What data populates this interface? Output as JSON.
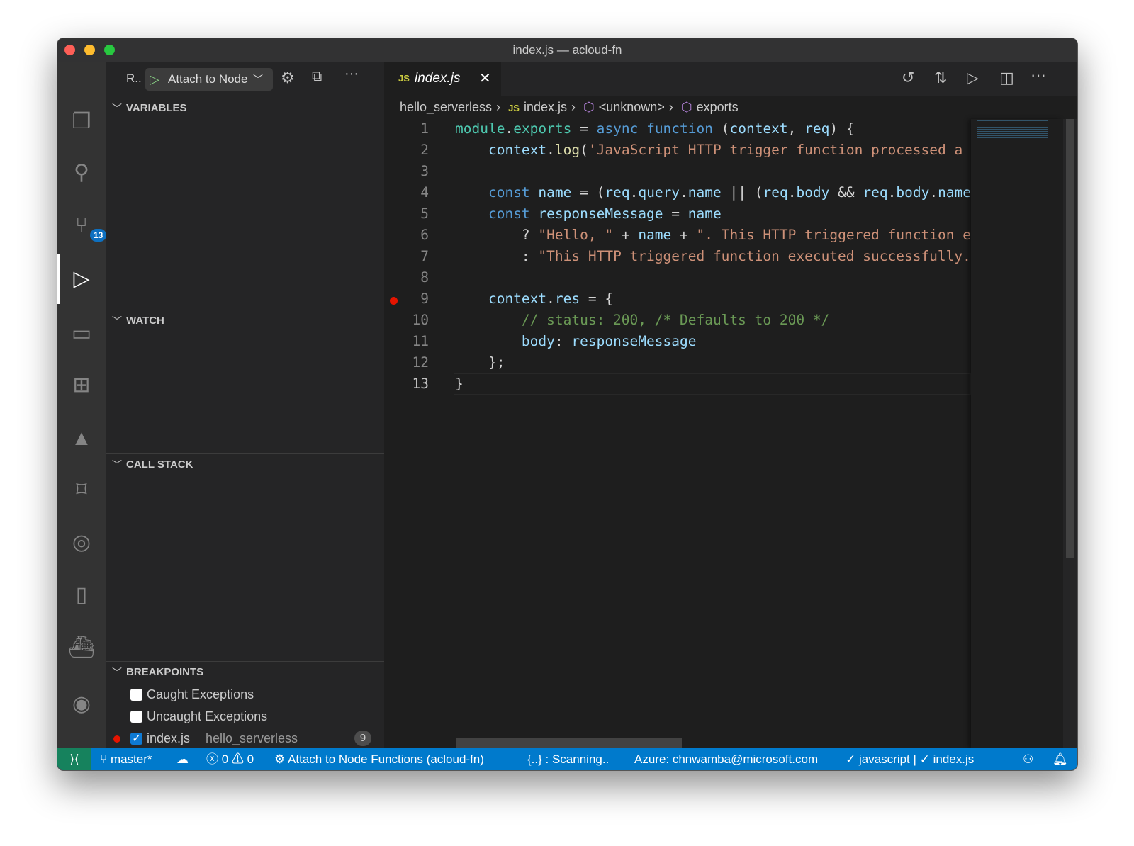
{
  "window": {
    "title": "index.js — acloud-fn"
  },
  "activity_bar": {
    "items": [
      "explorer-icon",
      "search-icon",
      "source-control-icon",
      "run-debug-icon",
      "remote-explorer-icon",
      "extensions-icon",
      "azure-icon",
      "bookmarks-icon",
      "git-graph-icon",
      "book-icon",
      "docker-icon",
      "account-icon",
      "settings-gear-icon"
    ],
    "scm_badge": "13"
  },
  "debug_toolbar": {
    "run_label": "R..",
    "config": "Attach to Node"
  },
  "sidebar": {
    "variables": "VARIABLES",
    "watch": "WATCH",
    "call_stack": "CALL STACK",
    "breakpoints": "BREAKPOINTS",
    "breakpoint_items": [
      {
        "label": "Caught Exceptions",
        "checked": false
      },
      {
        "label": "Uncaught Exceptions",
        "checked": false
      },
      {
        "label": "index.js",
        "path": "hello_serverless",
        "line": "9",
        "checked": true
      }
    ]
  },
  "editor": {
    "tab": {
      "label": "index.js",
      "icon": "JS"
    },
    "breadcrumb": [
      "hello_serverless",
      "index.js",
      "<unknown>",
      "exports"
    ],
    "current_line": "13",
    "breakpoint_line": "9",
    "lines": [
      [
        [
          "t",
          "module"
        ],
        [
          "p",
          "."
        ],
        [
          "t",
          "exports"
        ],
        [
          "p",
          " = "
        ],
        [
          "k",
          "async"
        ],
        [
          "p",
          " "
        ],
        [
          "k",
          "function"
        ],
        [
          "p",
          " ("
        ],
        [
          "v",
          "context"
        ],
        [
          "p",
          ", "
        ],
        [
          "v",
          "req"
        ],
        [
          "p",
          ") {"
        ]
      ],
      [
        [
          "p",
          "    "
        ],
        [
          "v",
          "context"
        ],
        [
          "p",
          "."
        ],
        [
          "f",
          "log"
        ],
        [
          "p",
          "("
        ],
        [
          "s",
          "'JavaScript HTTP trigger function processed a r"
        ]
      ],
      [],
      [
        [
          "p",
          "    "
        ],
        [
          "k",
          "const"
        ],
        [
          "p",
          " "
        ],
        [
          "v",
          "name"
        ],
        [
          "p",
          " = ("
        ],
        [
          "v",
          "req"
        ],
        [
          "p",
          "."
        ],
        [
          "v",
          "query"
        ],
        [
          "p",
          "."
        ],
        [
          "v",
          "name"
        ],
        [
          "p",
          " || ("
        ],
        [
          "v",
          "req"
        ],
        [
          "p",
          "."
        ],
        [
          "v",
          "body"
        ],
        [
          "p",
          " && "
        ],
        [
          "v",
          "req"
        ],
        [
          "p",
          "."
        ],
        [
          "v",
          "body"
        ],
        [
          "p",
          "."
        ],
        [
          "v",
          "name"
        ],
        [
          "p",
          ")"
        ]
      ],
      [
        [
          "p",
          "    "
        ],
        [
          "k",
          "const"
        ],
        [
          "p",
          " "
        ],
        [
          "v",
          "responseMessage"
        ],
        [
          "p",
          " = "
        ],
        [
          "v",
          "name"
        ]
      ],
      [
        [
          "p",
          "        ? "
        ],
        [
          "s",
          "\"Hello, \""
        ],
        [
          "p",
          " + "
        ],
        [
          "v",
          "name"
        ],
        [
          "p",
          " + "
        ],
        [
          "s",
          "\". This HTTP triggered function ex"
        ]
      ],
      [
        [
          "p",
          "        : "
        ],
        [
          "s",
          "\"This HTTP triggered function executed successfully."
        ]
      ],
      [],
      [
        [
          "p",
          "    "
        ],
        [
          "v",
          "context"
        ],
        [
          "p",
          "."
        ],
        [
          "v",
          "res"
        ],
        [
          "p",
          " = {"
        ]
      ],
      [
        [
          "p",
          "        "
        ],
        [
          "c",
          "// status: 200, /* Defaults to 200 */"
        ]
      ],
      [
        [
          "p",
          "        "
        ],
        [
          "v",
          "body"
        ],
        [
          "p",
          ": "
        ],
        [
          "v",
          "responseMessage"
        ]
      ],
      [
        [
          "p",
          "    };"
        ]
      ],
      [
        [
          "p",
          "}"
        ]
      ]
    ]
  },
  "status_bar": {
    "branch": "master*",
    "errors": "0",
    "warnings": "0",
    "debug": "Attach to Node Functions (acloud-fn)",
    "scanning": "{..} : Scanning..",
    "azure": "Azure: chnwamba@microsoft.com",
    "lint": "✓ javascript | ✓ index.js",
    "colors": {
      "bg": "#007acc",
      "remote": "#16825d"
    }
  }
}
